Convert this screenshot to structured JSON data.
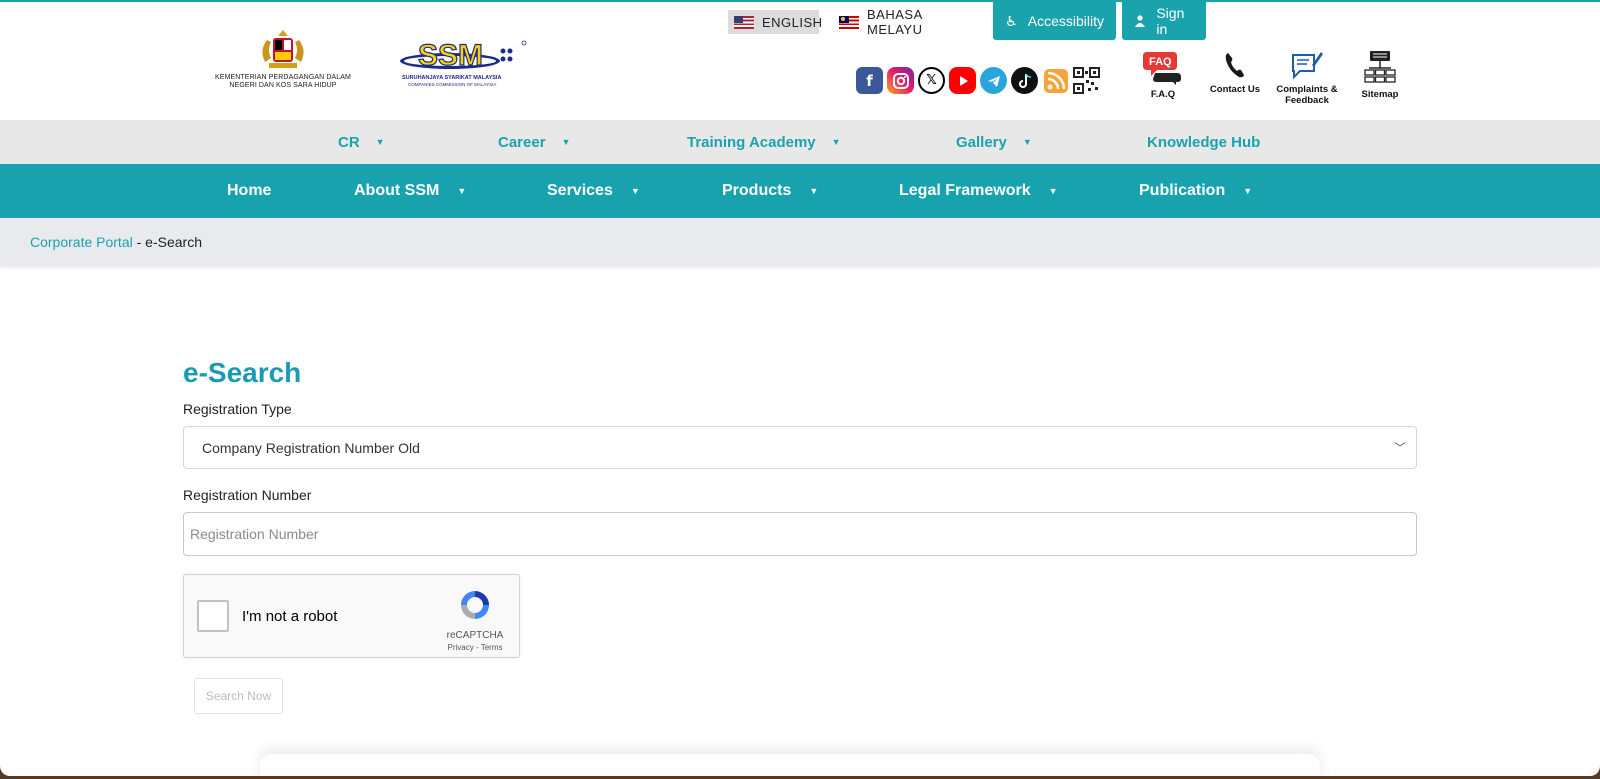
{
  "header": {
    "gov_logo_caption": "KEMENTERIAN PERDAGANGAN DALAM NEGERI DAN KOS SARA HIDUP",
    "ssm_logo_text": "SSM",
    "ssm_caption_1": "SURUHANJAYA SYARIKAT MALAYSIA",
    "ssm_caption_2": "COMPANIES COMMISSION OF MALAYSIA",
    "lang_english": "ENGLISH",
    "lang_malay": "BAHASA MELAYU",
    "accessibility": "Accessibility",
    "sign_in": "Sign in",
    "social_icons": [
      "facebook-icon",
      "instagram-icon",
      "x-icon",
      "youtube-icon",
      "telegram-icon",
      "tiktok-icon",
      "rss-icon",
      "qr-code-icon"
    ],
    "quick_links": {
      "faq": "F.A.Q",
      "faq_icon_text": "FAQ",
      "contact": "Contact Us",
      "complaints": "Complaints & Feedback",
      "sitemap": "Sitemap"
    }
  },
  "nav_secondary": [
    "CR",
    "Career",
    "Training Academy",
    "Gallery",
    "Knowledge Hub"
  ],
  "nav_primary": [
    "Home",
    "About SSM",
    "Services",
    "Products",
    "Legal Framework",
    "Publication"
  ],
  "breadcrumb": {
    "link": "Corporate Portal",
    "separator": " - ",
    "current": "e-Search"
  },
  "form": {
    "title": "e-Search",
    "registration_type_label": "Registration Type",
    "registration_type_value": "Company Registration Number Old",
    "registration_number_label": "Registration Number",
    "registration_number_placeholder": "Registration Number",
    "captcha_label": "I'm not a robot",
    "captcha_brand": "reCAPTCHA",
    "captcha_privacy": "Privacy",
    "captcha_terms": "Terms",
    "submit_label": "Search Now"
  },
  "colors": {
    "brand": "#17a2ad",
    "title": "#1a9bb5",
    "nav_secondary_bg": "#e8e8e8",
    "breadcrumb_bg": "#e9eaee"
  }
}
